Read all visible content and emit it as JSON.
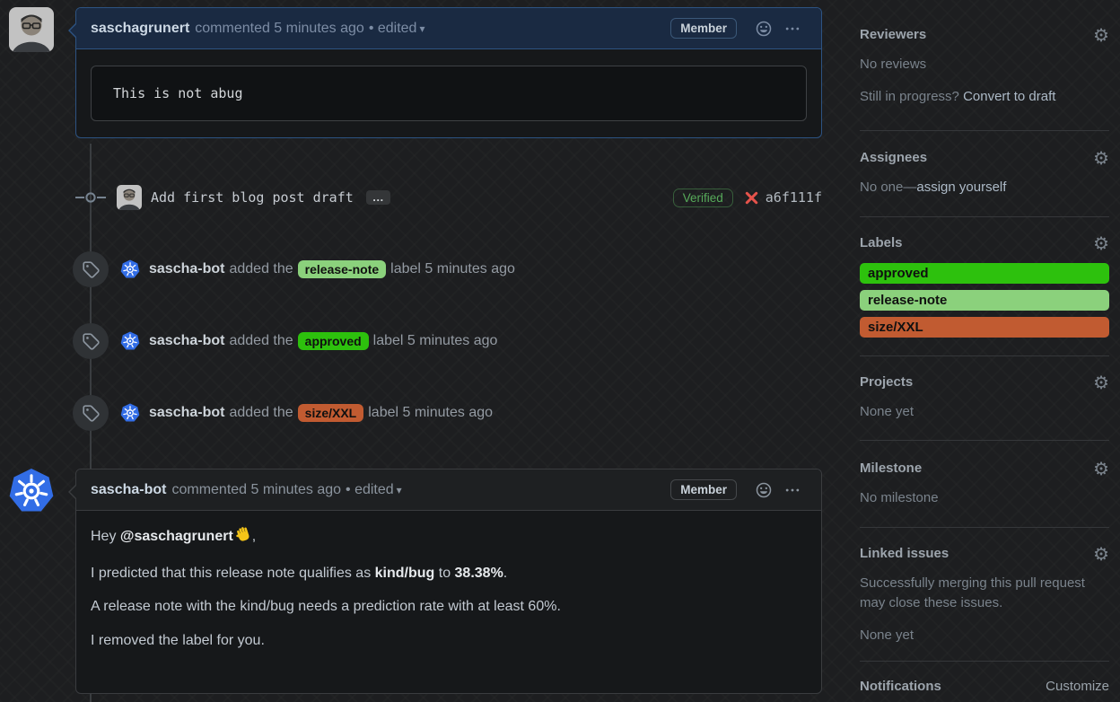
{
  "icons": {
    "gear": "⚙",
    "caret_down": "▾",
    "kebab": "horizontal-three-dots",
    "smiley": "smiley-face-outline",
    "tag": "tag-outline",
    "commit": "git-commit",
    "x": "red-x-mark",
    "wave": "waving-hand-emoji"
  },
  "colors": {
    "highlight_border": "#2d5382",
    "header1_bg": "#1a2a42",
    "verified_green": "#57ab5a",
    "error_red": "#e5534b",
    "kubernetes_blue": "#326de6",
    "label_approved": "#2dc10d",
    "label_release_note": "#8bd17c",
    "label_size_xxl": "#c15b31"
  },
  "comment1": {
    "author": "saschagrunert",
    "meta": "commented 5 minutes ago",
    "edited": "• edited",
    "member": "Member",
    "code": "This is not abug"
  },
  "commit": {
    "message": "Add first blog post draft",
    "expand": "…",
    "verified": "Verified",
    "sha": "a6f111f"
  },
  "events": [
    {
      "actor": "sascha-bot",
      "action": "added the",
      "label": "release-note",
      "suffix": "label 5 minutes ago",
      "color": "#8bd17c"
    },
    {
      "actor": "sascha-bot",
      "action": "added the",
      "label": "approved",
      "suffix": "label 5 minutes ago",
      "color": "#2dc10d"
    },
    {
      "actor": "sascha-bot",
      "action": "added the",
      "label": "size/XXL",
      "suffix": "label 5 minutes ago",
      "color": "#c15b31"
    }
  ],
  "comment2": {
    "author": "sascha-bot",
    "meta": "commented 5 minutes ago",
    "edited": "• edited",
    "member": "Member",
    "p1_prefix": "Hey ",
    "p1_mention": "@saschagrunert",
    "p1_suffix": ",",
    "p2_a": "I predicted that this release note qualifies as ",
    "p2_b1": "kind/bug",
    "p2_c": " to ",
    "p2_b2": "38.38%",
    "p2_d": ".",
    "p3": "A release note with the kind/bug needs a prediction rate with at least 60%.",
    "p4": "I removed the label for you."
  },
  "sidebar": {
    "reviewers": {
      "title": "Reviewers",
      "empty": "No reviews",
      "hint": "Still in progress?",
      "hint_link": "Convert to draft"
    },
    "assignees": {
      "title": "Assignees",
      "empty_prefix": "No one—",
      "assign_link": "assign yourself"
    },
    "labels": {
      "title": "Labels",
      "items": [
        {
          "name": "approved",
          "color": "#2dc10d"
        },
        {
          "name": "release-note",
          "color": "#8bd17c"
        },
        {
          "name": "size/XXL",
          "color": "#c15b31"
        }
      ]
    },
    "projects": {
      "title": "Projects",
      "empty": "None yet"
    },
    "milestone": {
      "title": "Milestone",
      "empty": "No milestone"
    },
    "linked_issues": {
      "title": "Linked issues",
      "desc": "Successfully merging this pull request may close these issues.",
      "empty": "None yet"
    },
    "notifications": {
      "title": "Notifications",
      "action": "Customize"
    }
  }
}
